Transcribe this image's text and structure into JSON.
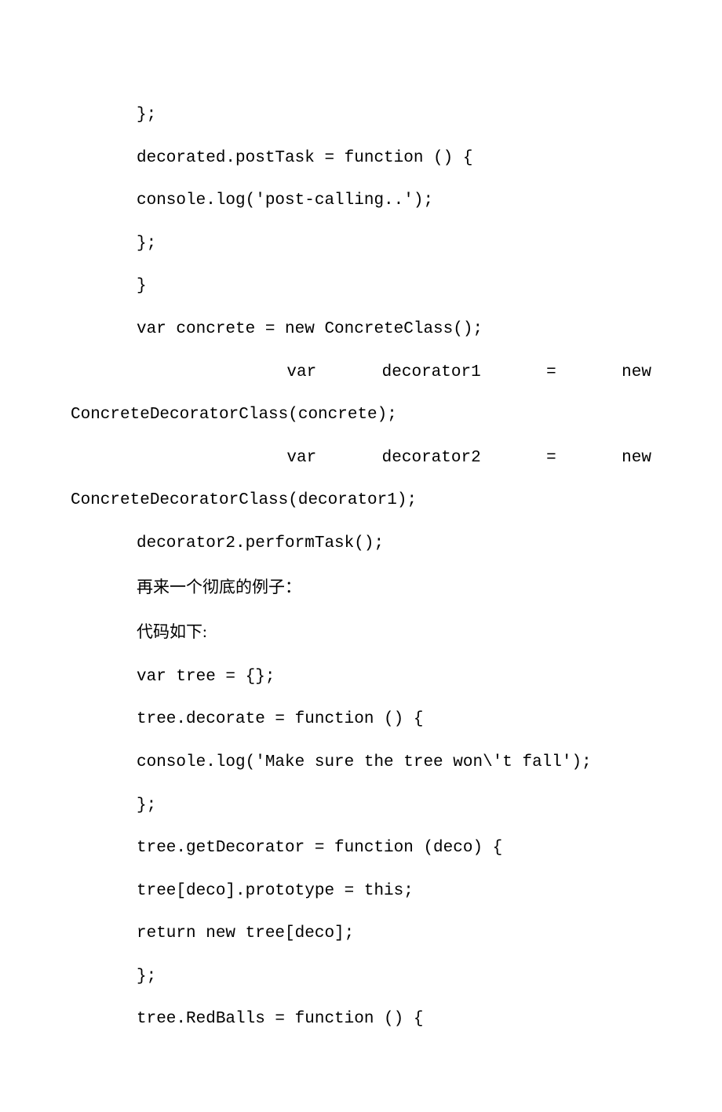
{
  "lines": {
    "l1": "};",
    "l2": "decorated.postTask = function () {",
    "l3": "console.log('post-calling..');",
    "l4": "};",
    "l5": "}",
    "l6": "var concrete = new ConcreteClass();",
    "j1": {
      "w1": "var",
      "w2": "decorator1",
      "w3": "=",
      "w4": "new"
    },
    "l7": "ConcreteDecoratorClass(concrete);",
    "j2": {
      "w1": "var",
      "w2": "decorator2",
      "w3": "=",
      "w4": "new"
    },
    "l8": "ConcreteDecoratorClass(decorator1);",
    "l9": "decorator2.performTask();",
    "l10": "再来一个彻底的例子：",
    "l11": "代码如下:",
    "l12": "var tree = {};",
    "l13": "tree.decorate = function () {",
    "l14": "console.log('Make sure the tree won\\'t fall');",
    "l15": "};",
    "l16": "tree.getDecorator = function (deco) {",
    "l17": "tree[deco].prototype = this;",
    "l18": "return new tree[deco];",
    "l19": "};",
    "l20": "tree.RedBalls = function () {"
  }
}
